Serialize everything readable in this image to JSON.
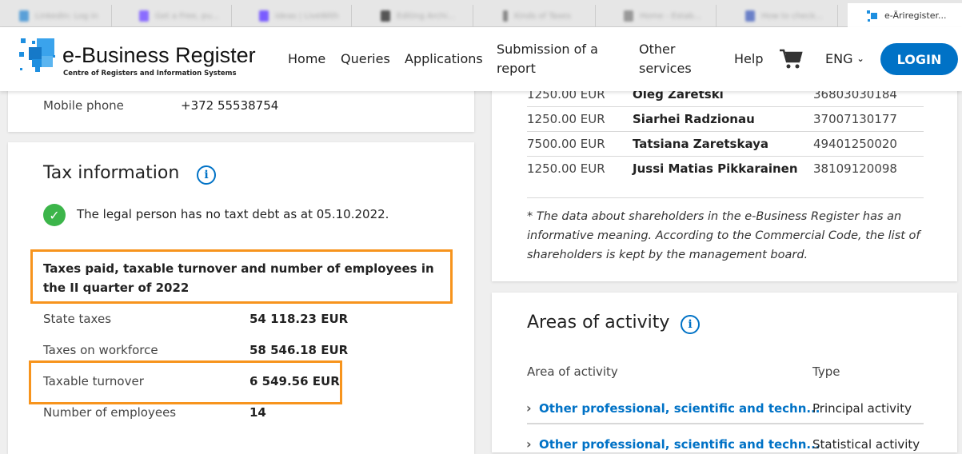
{
  "browser": {
    "tabs": [
      {
        "title": "LinkedIn: Log in",
        "color": "#5aa0d8"
      },
      {
        "title": "Get a Free, pu...",
        "color": "#8a6cff"
      },
      {
        "title": "Ideas | LiveWith",
        "color": "#7a5cff"
      },
      {
        "title": "Editing Archi...",
        "color": "#555555"
      },
      {
        "title": "Kinds of Taxes",
        "color": "#888888"
      },
      {
        "title": "Home - Estab...",
        "color": "#999999"
      },
      {
        "title": "How to check...",
        "color": "#6a80c8"
      }
    ],
    "active_tab": "e-Äriregister..."
  },
  "header": {
    "logo_title": "e-Business Register",
    "logo_subtitle": "Centre of Registers and Information Systems",
    "nav": [
      "Home",
      "Queries",
      "Applications",
      "Submission of a report",
      "Other services",
      "Help"
    ],
    "language": "ENG",
    "login": "LOGIN"
  },
  "contact": {
    "label": "Mobile phone",
    "value": "+372 55538754"
  },
  "tax": {
    "title": "Tax information",
    "debt_status": "The legal person has no taxt debt as at 05.10.2022.",
    "period_heading": "Taxes paid, taxable turnover and number of employees in the II quarter of 2022",
    "rows": [
      {
        "label": "State taxes",
        "value": "54 118.23 EUR"
      },
      {
        "label": "Taxes on workforce",
        "value": "58 546.18 EUR"
      },
      {
        "label": "Taxable turnover",
        "value": "6 549.56 EUR"
      },
      {
        "label": "Number of employees",
        "value": "14"
      }
    ]
  },
  "shareholders": {
    "rows": [
      {
        "amount": "1250.00 EUR",
        "name": "Oleg Zaretski",
        "code": "36803030184"
      },
      {
        "amount": "1250.00 EUR",
        "name": "Siarhei Radzionau",
        "code": "37007130177"
      },
      {
        "amount": "7500.00 EUR",
        "name": "Tatsiana Zaretskaya",
        "code": "49401250020"
      },
      {
        "amount": "1250.00 EUR",
        "name": "Jussi Matias Pikkarainen",
        "code": "38109120098"
      }
    ],
    "note": "* The data about shareholders in the e-Business Register has an informative meaning. According to the Commercial Code, the list of shareholders is kept by the management board."
  },
  "activity": {
    "title": "Areas of activity",
    "col_area": "Area of activity",
    "col_type": "Type",
    "rows": [
      {
        "area": "Other professional, scientific and techn...",
        "type": "Principal activity"
      },
      {
        "area": "Other professional, scientific and techn...",
        "type": "Statistical activity"
      }
    ]
  },
  "colors": {
    "accent": "#0072c6",
    "highlight": "#f7941d",
    "success": "#3cb54a"
  }
}
